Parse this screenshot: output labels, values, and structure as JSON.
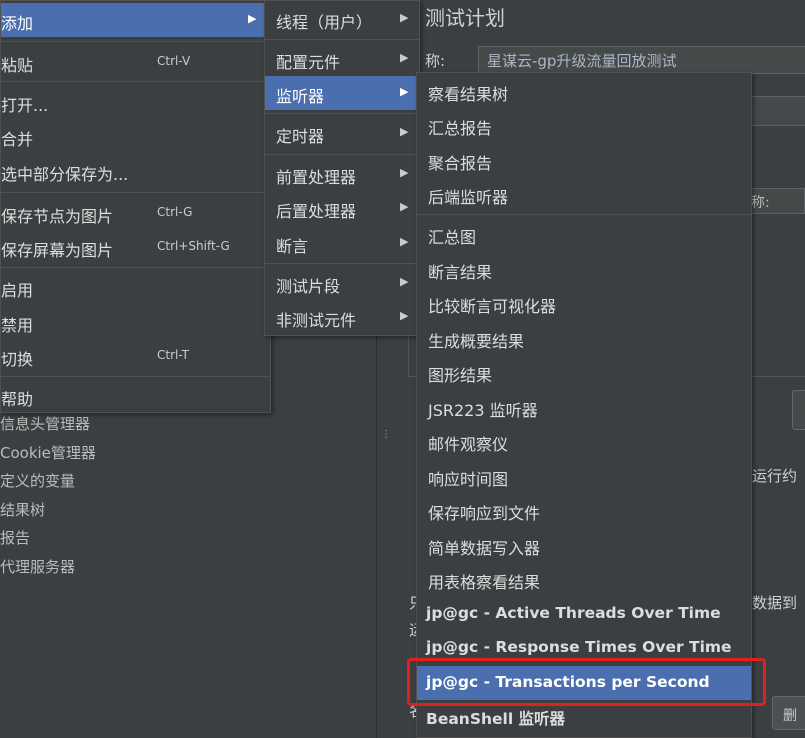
{
  "background": {
    "tree_items": [
      "信息头管理器",
      " Cookie管理器",
      "定义的变量",
      "结果树",
      "报告",
      "代理服务器"
    ],
    "title": "测试计划",
    "name_label": "称:",
    "name_value": "星谋云-gp升级流量回放测试",
    "user_label": "称:",
    "run_text": "运行约",
    "data_text": "数据到",
    "fragment_a": "只",
    "fragment_b": "运",
    "fragment_c": "名",
    "delete_label": "删"
  },
  "context_menu": {
    "items": [
      {
        "label": "添加",
        "shortcut": ""
      },
      {
        "label": "粘贴",
        "shortcut": "Ctrl-V"
      },
      {
        "label": "打开...",
        "shortcut": ""
      },
      {
        "label": "合并",
        "shortcut": ""
      },
      {
        "label": "选中部分保存为...",
        "shortcut": ""
      },
      {
        "label": "保存节点为图片",
        "shortcut": "Ctrl-G"
      },
      {
        "label": "保存屏幕为图片",
        "shortcut": "Ctrl+Shift-G"
      },
      {
        "label": "启用",
        "shortcut": ""
      },
      {
        "label": "禁用",
        "shortcut": ""
      },
      {
        "label": "切换",
        "shortcut": "Ctrl-T"
      },
      {
        "label": "帮助",
        "shortcut": ""
      }
    ]
  },
  "add_submenu": {
    "items": [
      "线程（用户）",
      "配置元件",
      "监听器",
      "定时器",
      "前置处理器",
      "后置处理器",
      "断言",
      "测试片段",
      "非测试元件"
    ]
  },
  "listener_submenu": {
    "items": [
      "察看结果树",
      "汇总报告",
      "聚合报告",
      "后端监听器",
      "汇总图",
      "断言结果",
      "比较断言可视化器",
      "生成概要结果",
      "图形结果",
      "JSR223 监听器",
      "邮件观察仪",
      "响应时间图",
      "保存响应到文件",
      "简单数据写入器",
      "用表格察看结果",
      "jp@gc - Active Threads Over Time",
      "jp@gc - Response Times Over Time",
      "jp@gc - Transactions per Second",
      "BeanShell 监听器"
    ]
  },
  "colors": {
    "highlight": "#4b6eaf",
    "menu_bg": "#3c3f41",
    "annotation_box": "#e0201a"
  },
  "icons": {
    "submenu_arrow": "▶",
    "splitter_grip": "⋮"
  }
}
